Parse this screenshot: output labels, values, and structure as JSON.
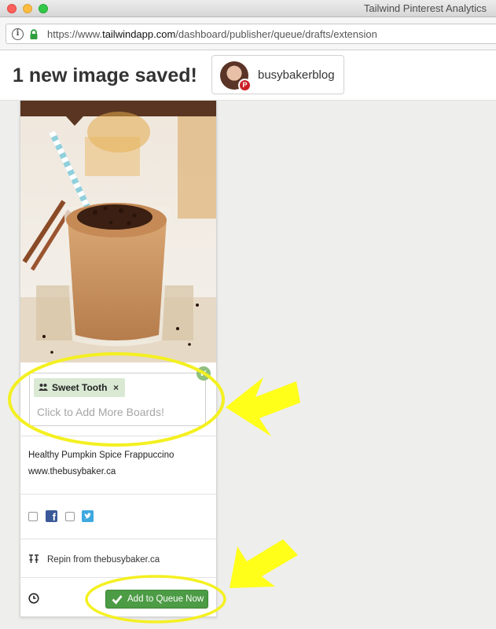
{
  "window": {
    "title": "Tailwind Pinterest Analytics"
  },
  "address_bar": {
    "url_prefix": "https://www.",
    "url_host": "tailwindapp.com",
    "url_path": "/dashboard/publisher/queue/drafts/extension"
  },
  "header": {
    "title": "1 new image saved!",
    "account_name": "busybakerblog",
    "account_badge": "P"
  },
  "pin": {
    "boards": [
      {
        "name": "Sweet Tooth",
        "remove": "×"
      }
    ],
    "add_boards_placeholder": "Click to Add More Boards!",
    "description_line1": "Healthy Pumpkin Spice Frappuccino",
    "description_line2": "www.thebusybaker.ca",
    "share": {
      "facebook_checked": false,
      "twitter_checked": false
    },
    "repin_text": "Repin from thebusybaker.ca",
    "queue_button_label": "Add to Queue Now"
  },
  "colors": {
    "queue_button": "#4c9b45",
    "board_tag": "#d9e9d4",
    "highlight": "#ffff00",
    "pinterest_red": "#cb2027"
  }
}
